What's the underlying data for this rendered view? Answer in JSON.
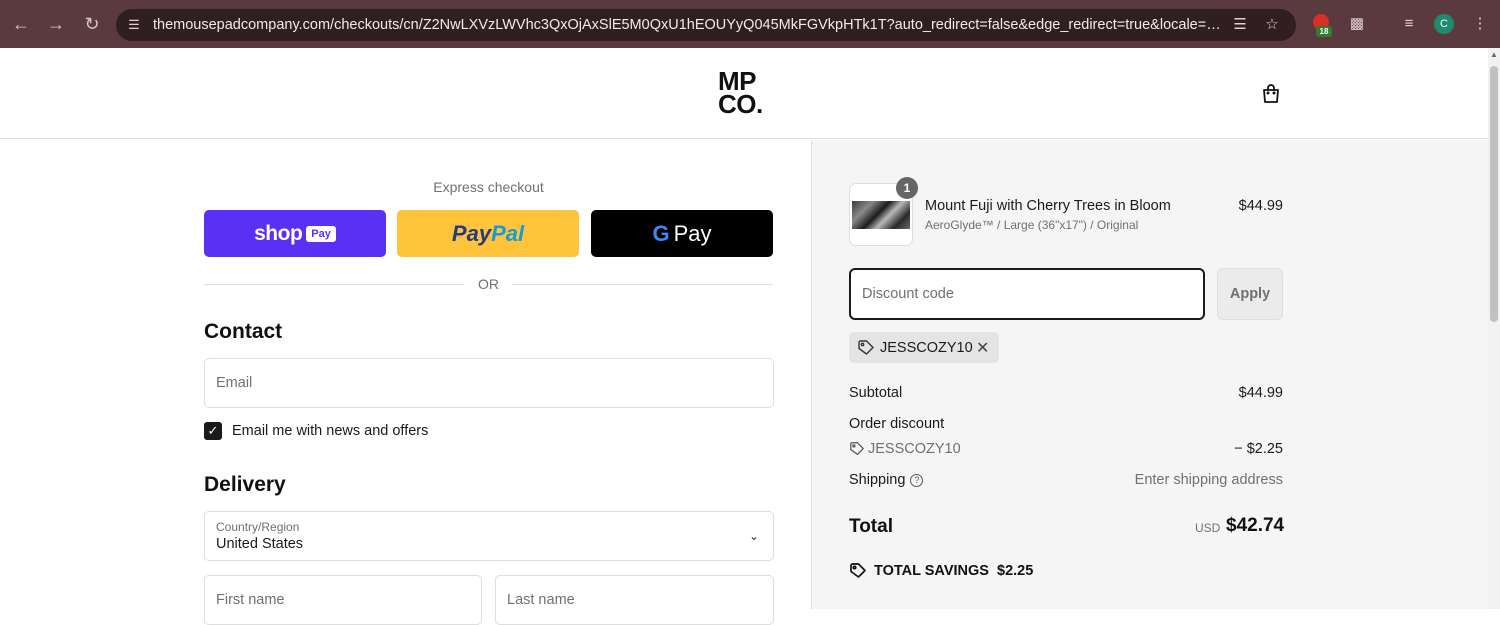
{
  "browser": {
    "url": "themousepadcompany.com/checkouts/cn/Z2NwLXVzLWVhc3QxOjAxSlE5M0QxU1hEOUYyQ045MkFGVkpHTk1T?auto_redirect=false&edge_redirect=true&locale=en-US&skip_...",
    "extension_badge": "18",
    "profile_initial": "C"
  },
  "header": {
    "logo_line1": "MP",
    "logo_line2": "CO."
  },
  "express": {
    "label": "Express checkout",
    "shop_word": "shop",
    "shop_pay": "Pay",
    "paypal_a": "Pay",
    "paypal_b": "Pal",
    "gpay_g": "G",
    "gpay_word": "Pay",
    "or": "OR"
  },
  "contact": {
    "title": "Contact",
    "email_placeholder": "Email",
    "newsletter_label": "Email me with news and offers",
    "newsletter_checked": true
  },
  "delivery": {
    "title": "Delivery",
    "country_label": "Country/Region",
    "country_value": "United States",
    "first_name_placeholder": "First name",
    "last_name_placeholder": "Last name"
  },
  "cart": {
    "item": {
      "quantity": "1",
      "name": "Mount Fuji with Cherry Trees in Bloom",
      "variant": "AeroGlyde™ / Large (36\"x17\") / Original",
      "price": "$44.99"
    },
    "discount_placeholder": "Discount code",
    "apply_label": "Apply",
    "applied_code": "JESSCOZY10",
    "subtotal_label": "Subtotal",
    "subtotal_value": "$44.99",
    "order_discount_label": "Order discount",
    "order_discount_code": "JESSCOZY10",
    "order_discount_value": "− $2.25",
    "shipping_label": "Shipping",
    "shipping_value": "Enter shipping address",
    "total_label": "Total",
    "total_currency": "USD",
    "total_value": "$42.74",
    "savings_label": "TOTAL SAVINGS",
    "savings_value": "$2.25"
  },
  "colors": {
    "chrome": "#5a3a3f",
    "shop_pay": "#5a31f4",
    "paypal": "#ffc439",
    "gpay": "#000000",
    "summary_bg": "#f5f5f5"
  }
}
